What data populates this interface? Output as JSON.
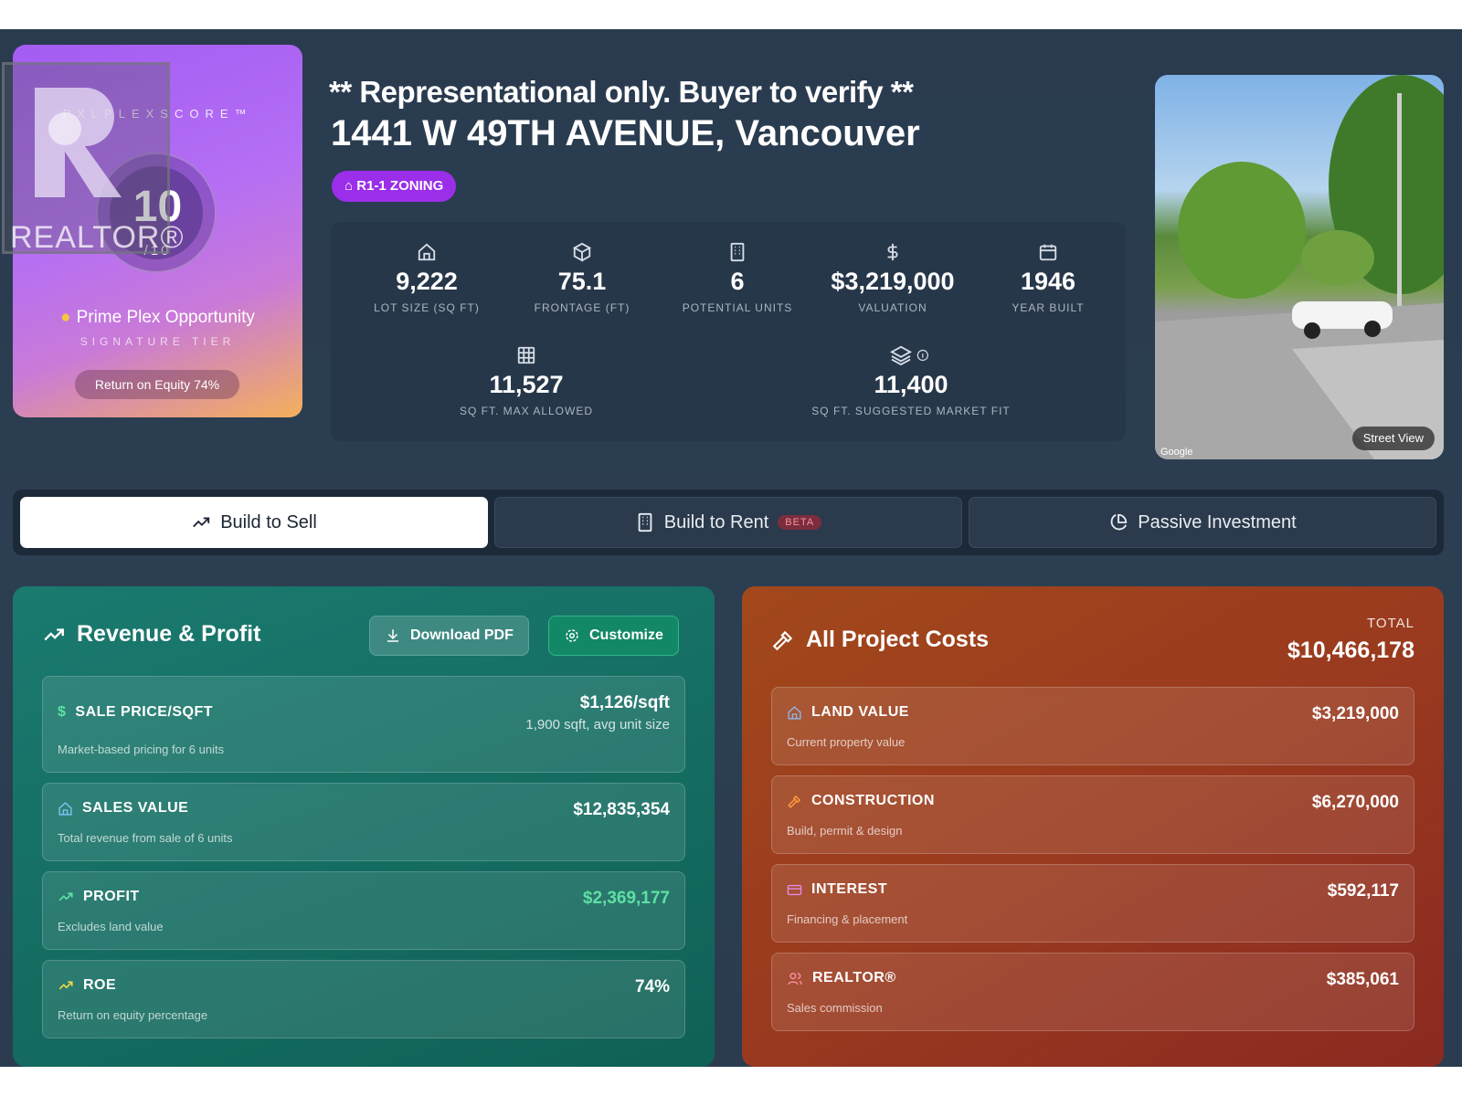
{
  "score": {
    "brand": "PXLPLEXSCORE™",
    "value": "10",
    "denominator": "/10",
    "title": "Prime Plex Opportunity",
    "tier": "SIGNATURE TIER",
    "roe_pill": "Return on Equity 74%"
  },
  "watermark": {
    "text": "REALTOR®"
  },
  "header": {
    "disclaimer": "** Representational only. Buyer to verify **",
    "address": "1441 W 49TH AVENUE, Vancouver",
    "zoning": "R1-1 ZONING"
  },
  "stats": [
    {
      "icon": "house-icon",
      "value": "9,222",
      "label": "LOT SIZE (SQ FT)"
    },
    {
      "icon": "box-icon",
      "value": "75.1",
      "label": "FRONTAGE (FT)"
    },
    {
      "icon": "building-icon",
      "value": "6",
      "label": "POTENTIAL UNITS"
    },
    {
      "icon": "dollar-icon",
      "value": "$3,219,000",
      "label": "VALUATION"
    },
    {
      "icon": "calendar-icon",
      "value": "1946",
      "label": "YEAR BUILT"
    },
    {
      "icon": "grid-icon",
      "value": "11,527",
      "label": "SQ FT. MAX ALLOWED"
    },
    {
      "icon": "layers-icon",
      "value": "11,400",
      "label": "SQ FT. SUGGESTED MARKET FIT"
    }
  ],
  "street": {
    "button": "Street View",
    "credit": "Google"
  },
  "tabs": [
    {
      "label": "Build to Sell",
      "active": true
    },
    {
      "label": "Build to Rent",
      "badge": "BETA"
    },
    {
      "label": "Passive Investment"
    }
  ],
  "revenue": {
    "title": "Revenue & Profit",
    "download_label": "Download PDF",
    "customize_label": "Customize",
    "items": [
      {
        "name": "SALE PRICE/SQFT",
        "sub": "Market-based pricing for 6 units",
        "amount": "$1,126/sqft",
        "amount2": "1,900 sqft, avg unit size"
      },
      {
        "name": "SALES VALUE",
        "sub": "Total revenue from sale of 6 units",
        "amount": "$12,835,354"
      },
      {
        "name": "PROFIT",
        "sub": "Excludes land value",
        "amount": "$2,369,177"
      },
      {
        "name": "ROE",
        "sub": "Return on equity percentage",
        "amount": "74%"
      }
    ]
  },
  "costs": {
    "title": "All Project Costs",
    "total_label": "TOTAL",
    "total_value": "$10,466,178",
    "items": [
      {
        "name": "LAND VALUE",
        "sub": "Current property value",
        "amount": "$3,219,000"
      },
      {
        "name": "CONSTRUCTION",
        "sub": "Build, permit & design",
        "amount": "$6,270,000"
      },
      {
        "name": "INTEREST",
        "sub": "Financing & placement",
        "amount": "$592,117"
      },
      {
        "name": "REALTOR®",
        "sub": "Sales commission",
        "amount": "$385,061"
      }
    ]
  },
  "colors": {
    "profit_green": "#5ee0a3",
    "roe_yellow": "#e8d84a",
    "zoning_purple": "#9b2ee8",
    "beta_red": "#ff8d9b"
  }
}
